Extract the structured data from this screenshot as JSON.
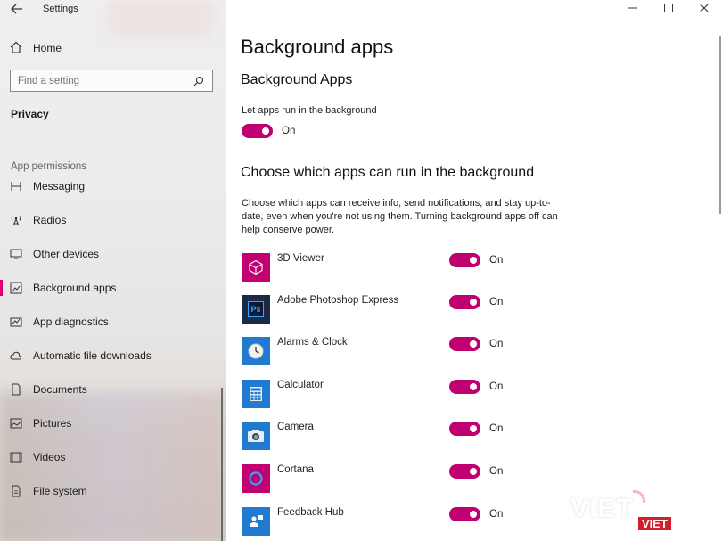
{
  "window": {
    "title": "Settings"
  },
  "sidebar": {
    "home_label": "Home",
    "search_placeholder": "Find a setting",
    "section_title": "Privacy",
    "group_label": "App permissions",
    "items": [
      {
        "label": "Messaging",
        "icon": "messaging-icon"
      },
      {
        "label": "Radios",
        "icon": "radios-icon"
      },
      {
        "label": "Other devices",
        "icon": "other-devices-icon"
      },
      {
        "label": "Background apps",
        "icon": "background-apps-icon",
        "active": true
      },
      {
        "label": "App diagnostics",
        "icon": "app-diagnostics-icon"
      },
      {
        "label": "Automatic file downloads",
        "icon": "cloud-icon"
      },
      {
        "label": "Documents",
        "icon": "document-icon"
      },
      {
        "label": "Pictures",
        "icon": "pictures-icon"
      },
      {
        "label": "Videos",
        "icon": "videos-icon"
      },
      {
        "label": "File system",
        "icon": "file-system-icon"
      }
    ]
  },
  "main": {
    "page_title": "Background apps",
    "section1_title": "Background Apps",
    "let_apps_label": "Let apps run in the background",
    "let_apps_state": "On",
    "section2_title": "Choose which apps can run in the background",
    "description": "Choose which apps can receive info, send notifications, and stay up-to-date, even when you're not using them. Turning background apps off can help conserve power.",
    "apps": [
      {
        "name": "3D Viewer",
        "state": "On",
        "icon": "3d-viewer-icon",
        "color": "#c30072"
      },
      {
        "name": "Adobe Photoshop Express",
        "state": "On",
        "icon": "photoshop-icon",
        "color": "#0d1a36"
      },
      {
        "name": "Alarms & Clock",
        "state": "On",
        "icon": "clock-icon",
        "color": "#1f7ad0"
      },
      {
        "name": "Calculator",
        "state": "On",
        "icon": "calculator-icon",
        "color": "#1f7ad0"
      },
      {
        "name": "Camera",
        "state": "On",
        "icon": "camera-icon",
        "color": "#1f7ad0"
      },
      {
        "name": "Cortana",
        "state": "On",
        "icon": "cortana-icon",
        "color": "#c30072"
      },
      {
        "name": "Feedback Hub",
        "state": "On",
        "icon": "feedback-hub-icon",
        "color": "#1f7ad0"
      }
    ]
  },
  "accent_color": "#c00070",
  "watermark": {
    "text": "VIET",
    "badge": "VIET"
  }
}
